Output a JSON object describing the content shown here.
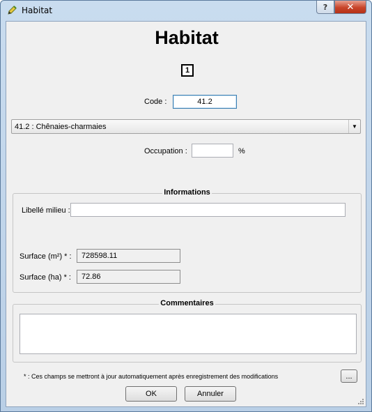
{
  "window": {
    "title": "Habitat",
    "help_glyph": "?",
    "close_glyph": "✕"
  },
  "form": {
    "heading": "Habitat",
    "id_value": "1",
    "code_label": "Code :",
    "code_value": "41.2",
    "habitat_select_value": "41.2 : Chênaies-charmaies",
    "occupation_label": "Occupation :",
    "occupation_value": "",
    "occupation_unit": "%"
  },
  "informations": {
    "title": "Informations",
    "libelle_label": "Libellé milieu :",
    "libelle_value": "",
    "surface_m2_label": "Surface (m²) * :",
    "surface_m2_value": "728598.11",
    "surface_ha_label": "Surface (ha) * :",
    "surface_ha_value": "72.86"
  },
  "commentaires": {
    "title": "Commentaires",
    "value": ""
  },
  "footer": {
    "note": "* : Ces champs se mettront à jour automatiquement après enregistrement des modifications",
    "more_label": "...",
    "ok_label": "OK",
    "cancel_label": "Annuler"
  },
  "icons": {
    "app": "pencil-icon",
    "help": "help-icon",
    "close": "close-icon",
    "dropdown": "chevron-down-icon",
    "resize": "resize-grip-icon"
  },
  "colors": {
    "titlebar": "#c9dcef",
    "dialog_bg": "#f0f0f0",
    "close_button": "#c8442a",
    "focus_border": "#3c7fb1"
  }
}
